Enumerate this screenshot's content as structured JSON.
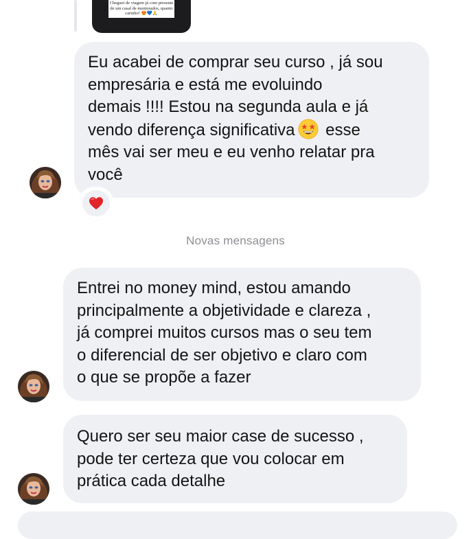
{
  "reply_preview": {
    "caption": "Cheguei de viagem já com presente de um casal de mentorados, quanto carinho! 😍💙🙏"
  },
  "messages": [
    {
      "text_before_emoji": "Eu acabei de comprar seu curso , já sou\nempresária e está me evoluindo\ndemais !!!! Estou na segunda aula e já\nvendo diferença significativa",
      "emoji": "star-struck-emoji",
      "text_after_emoji": " esse\nmês vai ser meu e eu venho relatar pra\nvocê",
      "reaction": "❤️"
    },
    {
      "text": "Entrei no money mind, estou amando\nprincipalmente a objetividade e clareza ,\njá comprei muitos cursos mas o seu tem\no diferencial de ser objetivo e claro com\no que se propõe a fazer"
    },
    {
      "text": "Quero ser seu maior case de sucesso ,\npode ter certeza que vou colocar em\nprática cada detalhe"
    }
  ],
  "divider": {
    "label": "Novas mensagens"
  },
  "colors": {
    "bubble_bg": "#eff0f4",
    "text": "#141414",
    "divider_text": "#8e8e93",
    "reaction_heart": "#e0242a"
  }
}
